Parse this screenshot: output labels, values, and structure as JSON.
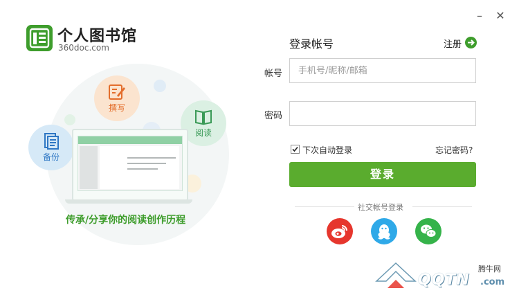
{
  "window": {
    "minimize_symbol": "–",
    "close_symbol": "✕"
  },
  "brand": {
    "title": "个人图书馆",
    "subtitle": "360doc.com",
    "accent": "#3e9d2c",
    "logo_icon": "library-logo-icon"
  },
  "illustration": {
    "features": [
      {
        "label": "撰写",
        "icon": "edit-icon"
      },
      {
        "label": "阅读",
        "icon": "book-icon"
      },
      {
        "label": "备份",
        "icon": "document-icon"
      }
    ],
    "caption": "传承/分享你的阅读创作历程"
  },
  "login": {
    "title": "登录帐号",
    "register": "注册",
    "account_label": "帐号",
    "account_placeholder": "手机号/昵称/邮箱",
    "account_value": "",
    "password_label": "密码",
    "password_value": "",
    "remember_label": "下次自动登录",
    "remember_checked": true,
    "forgot": "忘记密码?",
    "submit": "登录",
    "button_color": "#5aac2e"
  },
  "social": {
    "label": "社交帐号登录",
    "providers": [
      {
        "name": "weibo",
        "icon": "weibo-icon",
        "color": "#e6362d"
      },
      {
        "name": "qq",
        "icon": "qq-icon",
        "color": "#2fa9e8"
      },
      {
        "name": "wechat",
        "icon": "wechat-icon",
        "color": "#35b34a"
      }
    ]
  },
  "watermark": {
    "site": "腾牛网",
    "logo_text": "QQTN",
    "domain": ".com"
  }
}
